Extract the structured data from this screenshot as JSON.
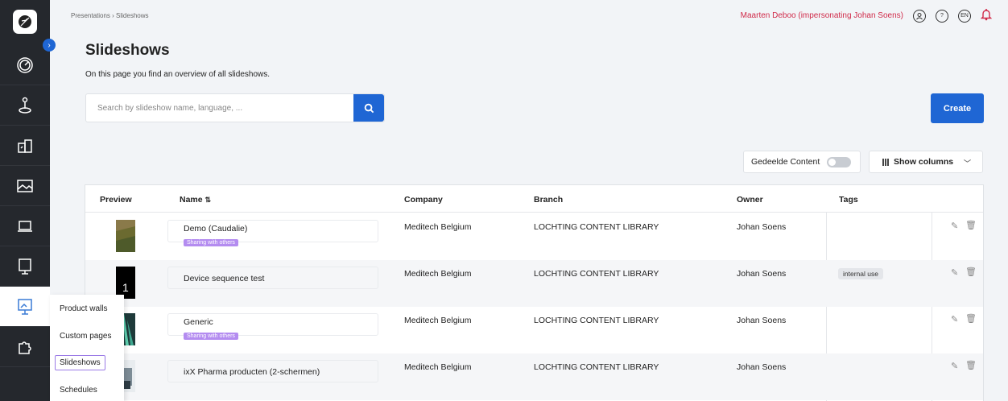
{
  "breadcrumb": "Presentations  ›  Slideshows",
  "user": {
    "impersonation": "Maarten Deboo (impersonating Johan Soens)",
    "language": "EN"
  },
  "page": {
    "title": "Slideshows",
    "description": "On this page you find an overview of all slideshows."
  },
  "search": {
    "placeholder": "Search by slideshow name, language, ..."
  },
  "create_label": "Create",
  "shared_content_label": "Gedeelde Content",
  "show_columns_label": "Show columns",
  "submenu": {
    "items": [
      "Product walls",
      "Custom pages",
      "Slideshows",
      "Schedules"
    ],
    "active": "Slideshows"
  },
  "table": {
    "headers": {
      "preview": "Preview",
      "name": "Name",
      "company": "Company",
      "branch": "Branch",
      "owner": "Owner",
      "tags": "Tags"
    },
    "rows": [
      {
        "name": "Demo (Caudalie)",
        "badge": "Sharing with others",
        "company": "Meditech Belgium",
        "branch": "LOCHTING CONTENT LIBRARY",
        "owner": "Johan Soens",
        "tag": ""
      },
      {
        "name": "Device sequence test",
        "badge": "",
        "preview_text": "1",
        "company": "Meditech Belgium",
        "branch": "LOCHTING CONTENT LIBRARY",
        "owner": "Johan Soens",
        "tag": "internal use"
      },
      {
        "name": "Generic",
        "badge": "Sharing with others",
        "company": "Meditech Belgium",
        "branch": "LOCHTING CONTENT LIBRARY",
        "owner": "Johan Soens",
        "tag": ""
      },
      {
        "name": "ixX Pharma producten (2-schermen)",
        "badge": "",
        "company": "Meditech Belgium",
        "branch": "LOCHTING CONTENT LIBRARY",
        "owner": "Johan Soens",
        "tag": ""
      }
    ]
  },
  "colors": {
    "primary": "#1f66d4",
    "rail": "#25282d",
    "alert": "#d02a49",
    "badge": "#b48cf0"
  }
}
